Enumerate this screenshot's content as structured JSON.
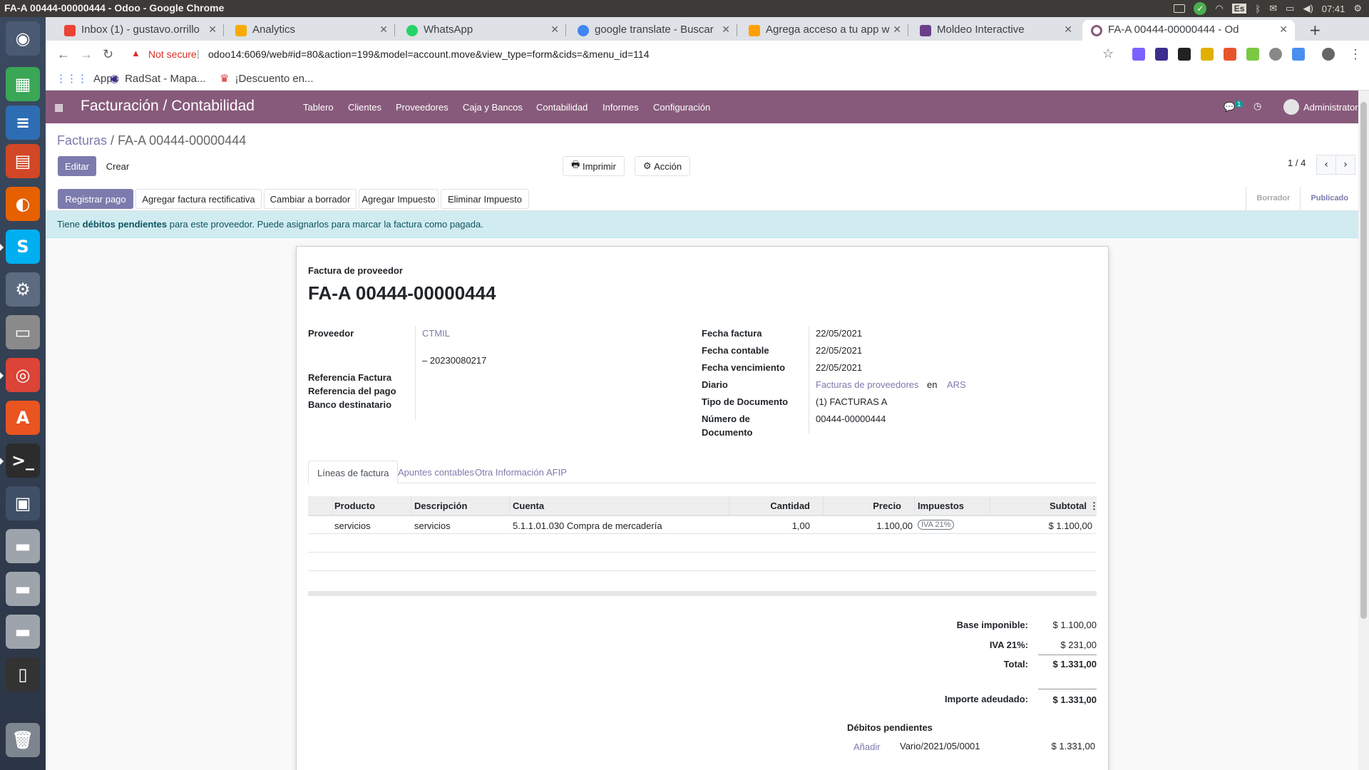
{
  "window_title": "FA-A 00444-00000444 - Odoo - Google Chrome",
  "tray": {
    "lang": "Es",
    "time": "07:41"
  },
  "tabs": [
    {
      "label": "Inbox (1) - gustavo.orrillo",
      "color": "#ea4335"
    },
    {
      "label": "Analytics",
      "color": "#f9ab00"
    },
    {
      "label": "WhatsApp",
      "color": "#25d366"
    },
    {
      "label": "google translate - Buscar",
      "color": "#4285f4"
    },
    {
      "label": "Agrega acceso a tu app w",
      "color": "#ffa000"
    },
    {
      "label": "Moldeo Interactive",
      "color": "#6a3e8a"
    },
    {
      "label": "FA-A 00444-00000444 - Od",
      "color": "#875a7b"
    }
  ],
  "url": {
    "not_secure": "Not secure",
    "address": "odoo14:6069/web#id=80&action=199&model=account.move&view_type=form&cids=&menu_id=114"
  },
  "bookmarks": [
    "Apps",
    "RadSat - Mapa...",
    "¡Descuento en..."
  ],
  "odoo": {
    "brand": "Facturación / Contabilidad",
    "menu": [
      "Tablero",
      "Clientes",
      "Proveedores",
      "Caja y Bancos",
      "Contabilidad",
      "Informes",
      "Configuración"
    ],
    "chat_count": "1",
    "user": "Administrator"
  },
  "breadcrumb": {
    "parent": "Facturas",
    "sep": "/",
    "current": "FA-A 00444-00000444"
  },
  "buttons": {
    "edit": "Editar",
    "create": "Crear",
    "print": "Imprimir",
    "action": "Acción"
  },
  "pager": {
    "value": "1 / 4"
  },
  "header_buttons": [
    "Registrar pago",
    "Agregar factura rectificativa",
    "Cambiar a borrador",
    "Agregar Impuesto",
    "Eliminar Impuesto"
  ],
  "stages": [
    "Borrador",
    "Publicado"
  ],
  "alert": {
    "pre": "Tiene ",
    "bold": "débitos pendientes",
    "post": " para este proveedor. Puede asignarlos para marcar la factura como pagada."
  },
  "invoice": {
    "type": "Factura de proveedor",
    "number": "FA-A 00444-00000444",
    "left": {
      "proveedor_label": "Proveedor",
      "proveedor": "CTMIL",
      "cuit": "– 20230080217",
      "ref_factura": "Referencia Factura",
      "ref_pago": "Referencia del pago",
      "banco": "Banco destinatario"
    },
    "right": {
      "fecha_factura_label": "Fecha factura",
      "fecha_factura": "22/05/2021",
      "fecha_contable_label": "Fecha contable",
      "fecha_contable": "22/05/2021",
      "fecha_venc_label": "Fecha vencimiento",
      "fecha_venc": "22/05/2021",
      "diario_label": "Diario",
      "diario": "Facturas de proveedores",
      "en": "en",
      "moneda": "ARS",
      "tipo_doc_label": "Tipo de Documento",
      "tipo_doc": "(1) FACTURAS A",
      "num_doc_label_1": "Número de",
      "num_doc_label_2": "Documento",
      "num_doc": "00444-00000444"
    }
  },
  "notebook_tabs": [
    "Líneas de factura",
    "Apuntes contables",
    "Otra Información",
    "AFIP"
  ],
  "lines": {
    "headers": [
      "Producto",
      "Descripción",
      "Cuenta",
      "Cantidad",
      "Precio",
      "Impuestos",
      "Subtotal"
    ],
    "rows": [
      {
        "producto": "servicios",
        "descripcion": "servicios",
        "cuenta": "5.1.1.01.030 Compra de mercadería",
        "cantidad": "1,00",
        "precio": "1.100,00",
        "impuestos": "IVA 21%",
        "subtotal": "$ 1.100,00"
      }
    ]
  },
  "totals": {
    "base_label": "Base imponible:",
    "base": "$ 1.100,00",
    "iva_label": "IVA 21%:",
    "iva": "$ 231,00",
    "total_label": "Total:",
    "total": "$ 1.331,00",
    "due_label": "Importe adeudado:",
    "due": "$ 1.331,00"
  },
  "outstanding": {
    "title": "Débitos pendientes",
    "add": "Añadir",
    "ref": "Vario/2021/05/0001",
    "amount": "$ 1.331,00"
  }
}
